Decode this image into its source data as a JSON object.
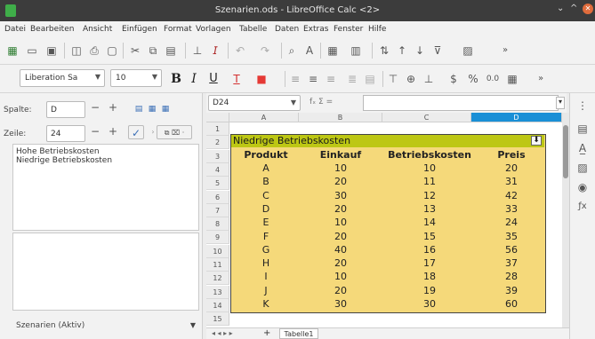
{
  "window": {
    "title": "Szenarien.ods - LibreOffice Calc <2>",
    "minimize": "⌄",
    "maximize": "^",
    "close": "✕"
  },
  "menu": [
    "Datei",
    "Bearbeiten",
    "Ansicht",
    "Einfügen",
    "Format",
    "Vorlagen",
    "Tabelle",
    "Daten",
    "Extras",
    "Fenster",
    "Hilfe"
  ],
  "toolbar": {
    "font_name": "Liberation Sa",
    "font_size": "10",
    "bold": "B",
    "italic": "I",
    "underline": "U",
    "currency": "$",
    "percent": "%",
    "decimals": "0.0",
    "overflow": "»"
  },
  "navigator": {
    "column_label": "Spalte:",
    "column_value": "D",
    "row_label": "Zeile:",
    "row_value": "24",
    "minus": "−",
    "plus": "+"
  },
  "scenarios": {
    "items": [
      "Hohe Betriebskosten",
      "Niedrige Betriebskosten"
    ],
    "footer": "Szenarien (Aktiv)"
  },
  "formula": {
    "namebox": "D24",
    "function_symbols": "fₓ Σ ="
  },
  "sheet": {
    "columns": [
      "A",
      "B",
      "C",
      "D"
    ],
    "rows": [
      "1",
      "2",
      "3",
      "4",
      "5",
      "6",
      "7",
      "8",
      "9",
      "10",
      "11",
      "12",
      "13",
      "14",
      "15"
    ],
    "scenario_name": "Niedrige Betriebskosten",
    "headers": [
      "Produkt",
      "Einkauf",
      "Betriebskosten",
      "Preis"
    ],
    "data": [
      [
        "A",
        "10",
        "10",
        "20"
      ],
      [
        "B",
        "20",
        "11",
        "31"
      ],
      [
        "C",
        "30",
        "12",
        "42"
      ],
      [
        "D",
        "20",
        "13",
        "33"
      ],
      [
        "E",
        "10",
        "14",
        "24"
      ],
      [
        "F",
        "20",
        "15",
        "35"
      ],
      [
        "G",
        "40",
        "16",
        "56"
      ],
      [
        "H",
        "20",
        "17",
        "37"
      ],
      [
        "I",
        "10",
        "18",
        "28"
      ],
      [
        "J",
        "20",
        "19",
        "39"
      ],
      [
        "K",
        "30",
        "30",
        "60"
      ]
    ]
  },
  "tabs": {
    "active": "Tabelle1",
    "add": "+",
    "nav": "◂ ◂ ▸ ▸"
  },
  "colors": {
    "scenario_header": "#bdc714",
    "scenario_fill": "#f5d97a",
    "active_column": "#1a8fd6"
  }
}
